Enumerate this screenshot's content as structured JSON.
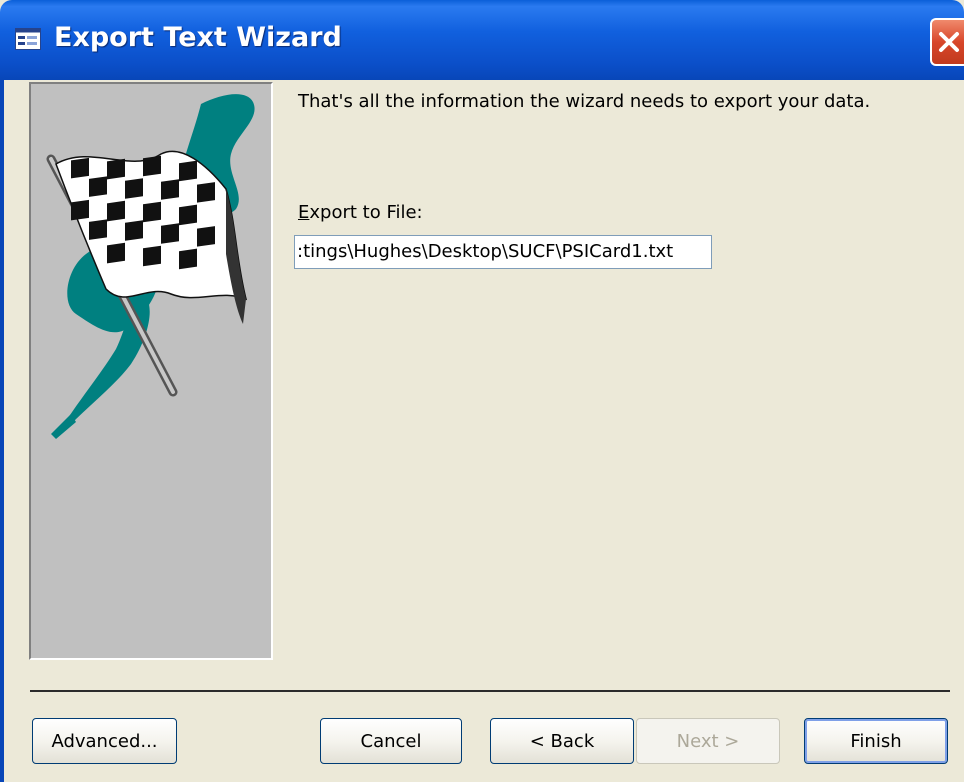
{
  "window": {
    "title": "Export Text Wizard",
    "icon": "form-icon",
    "close_icon": "close-icon"
  },
  "content": {
    "message": "That's all the information the wizard needs to export your data.",
    "export_label": "Export to File:",
    "export_path": ":tings\\Hughes\\Desktop\\SUCF\\PSICard1.txt"
  },
  "image": {
    "icon": "checkered-flag-icon",
    "colors": {
      "panel": "#c0c0c0",
      "splash": "#008080"
    }
  },
  "buttons": {
    "advanced": "Advanced...",
    "cancel": "Cancel",
    "back": "< Back",
    "next": "Next >",
    "finish": "Finish"
  }
}
